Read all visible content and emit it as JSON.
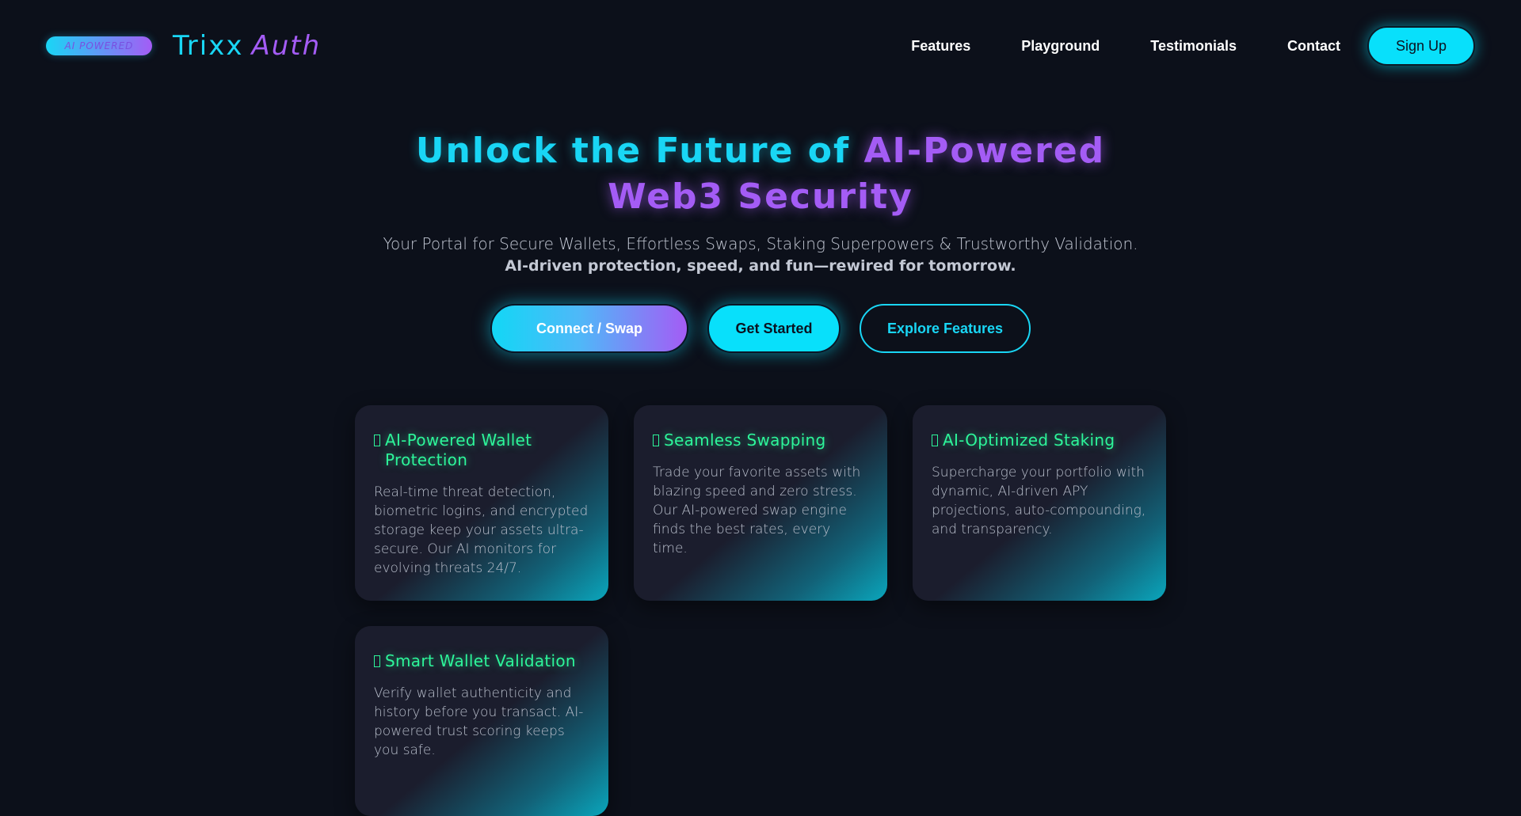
{
  "nav": {
    "badge": "AI POWERED",
    "brand_first": "Trixx",
    "brand_second": "Auth",
    "links": [
      "Features",
      "Playground",
      "Testimonials",
      "Contact"
    ],
    "signup_label": "Sign Up"
  },
  "hero": {
    "title_part1": "Unlock the Future of",
    "title_part2": "AI-Powered",
    "title_part3": "Web3 Security",
    "subtitle": "Your Portal for Secure Wallets, Effortless Swaps, Staking Superpowers & Trustworthy Validation.",
    "tagline": "AI-driven protection, speed, and fun—rewired for tomorrow.",
    "cta_connect": "Connect / Swap",
    "cta_started": "Get Started",
    "cta_explore": "Explore Features"
  },
  "features": [
    {
      "icon": "shield-icon",
      "title": "AI-Powered Wallet Protection",
      "desc": "Real-time threat detection, biometric logins, and encrypted storage keep your assets ultra-secure. Our AI monitors for evolving threats 24/7."
    },
    {
      "icon": "swap-icon",
      "title": "Seamless Swapping",
      "desc": "Trade your favorite assets with blazing speed and zero stress. Our AI-powered swap engine finds the best rates, every time."
    },
    {
      "icon": "staking-icon",
      "title": "AI-Optimized Staking",
      "desc": "Supercharge your portfolio with dynamic, AI-driven APY projections, auto-compounding, and transparency."
    },
    {
      "icon": "validation-icon",
      "title": "Smart Wallet Validation",
      "desc": "Verify wallet authenticity and history before you transact. AI-powered trust scoring keeps you safe."
    }
  ],
  "colors": {
    "background": "#0c101a",
    "cyan": "#19d6f5",
    "purple": "#a45cf5",
    "green": "#2df59a",
    "card": "#1b1d2d"
  }
}
